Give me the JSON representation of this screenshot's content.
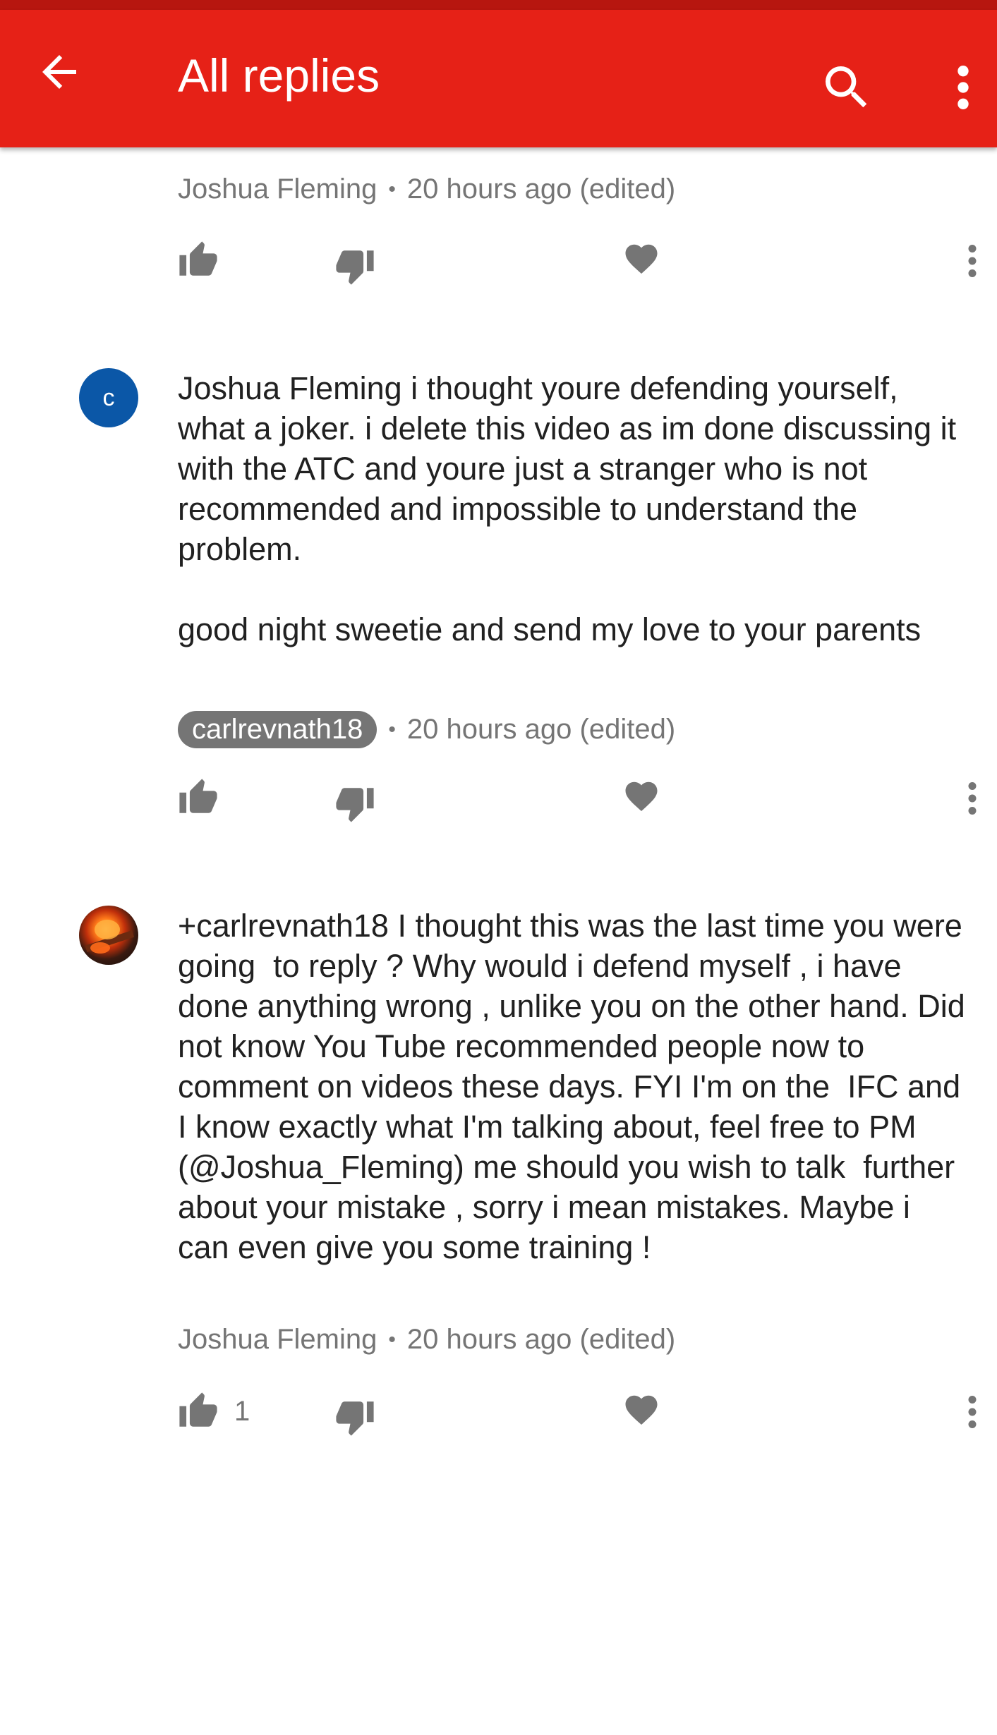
{
  "appbar": {
    "title": "All replies",
    "icons": [
      "back-arrow-icon",
      "search-icon",
      "more-vert-icon"
    ],
    "color": "#e62117"
  },
  "comments": [
    {
      "author": "Joshua Fleming",
      "time": "20 hours ago (edited)",
      "text_clipped": "",
      "likes": ""
    },
    {
      "avatar_letter": "c",
      "author": "carlrevnath18",
      "time": "20 hours ago (edited)",
      "text": "Joshua Fleming i thought youre defending yourself, what a joker. i delete this video as im done discussing it with the ATC and youre just a stranger who is not recommended and impossible to understand the problem.\n\ngood night sweetie and send my love to your parents",
      "likes": ""
    },
    {
      "author": "Joshua Fleming",
      "time": "20 hours ago (edited)",
      "text": "+carlrevnath18 I thought this was the last time you were going  to reply ? Why would i defend myself , i have done anything wrong , unlike you on the other hand. Did not know You Tube recommended people now to comment on videos these days. FYI I'm on the  IFC and I know exactly what I'm talking about, feel free to PM (@Joshua_Fleming) me should you wish to talk  further about your mistake , sorry i mean mistakes. Maybe i can even give you some training !",
      "likes": "1"
    }
  ],
  "separator": "•"
}
